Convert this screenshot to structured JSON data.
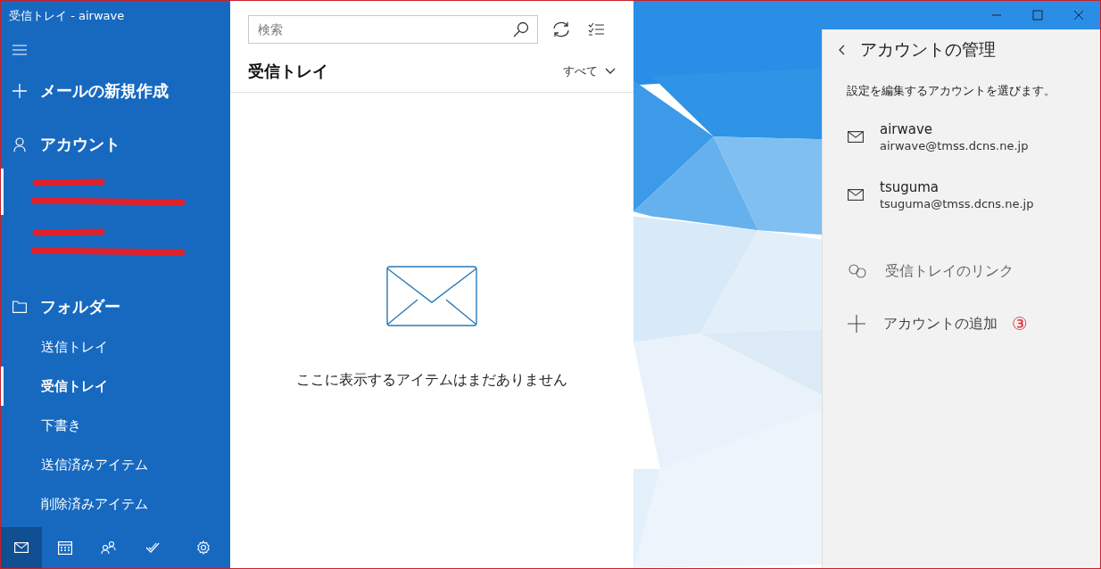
{
  "window": {
    "title": "受信トレイ - airwave"
  },
  "sidebar": {
    "compose": "メールの新規作成",
    "accounts_heading": "アカウント",
    "accounts": [
      {
        "selected": true
      },
      {
        "selected": false
      }
    ],
    "folders_heading": "フォルダー",
    "folders": [
      {
        "label": "送信トレイ",
        "selected": false
      },
      {
        "label": "受信トレイ",
        "selected": true
      },
      {
        "label": "下書き",
        "selected": false
      },
      {
        "label": "送信済みアイテム",
        "selected": false
      },
      {
        "label": "削除済みアイテム",
        "selected": false
      }
    ],
    "nav": [
      {
        "kind": "mail",
        "selected": true
      },
      {
        "kind": "calendar",
        "selected": false
      },
      {
        "kind": "people",
        "selected": false
      },
      {
        "kind": "todo",
        "selected": false
      },
      {
        "kind": "settings",
        "selected": false
      }
    ]
  },
  "list": {
    "search": {
      "placeholder": "検索"
    },
    "title": "受信トレイ",
    "filter": "すべて",
    "empty_message": "ここに表示するアイテムはまだありません"
  },
  "panel": {
    "title": "アカウントの管理",
    "subtitle": "設定を編集するアカウントを選びます。",
    "accounts": [
      {
        "name": "airwave",
        "email": "airwave@tmss.dcns.ne.jp"
      },
      {
        "name": "tsuguma",
        "email": "tsuguma@tmss.dcns.ne.jp"
      }
    ],
    "actions": [
      {
        "kind": "link",
        "label": "受信トレイのリンク"
      },
      {
        "kind": "add",
        "label": "アカウントの追加"
      }
    ],
    "annotation": "③"
  }
}
